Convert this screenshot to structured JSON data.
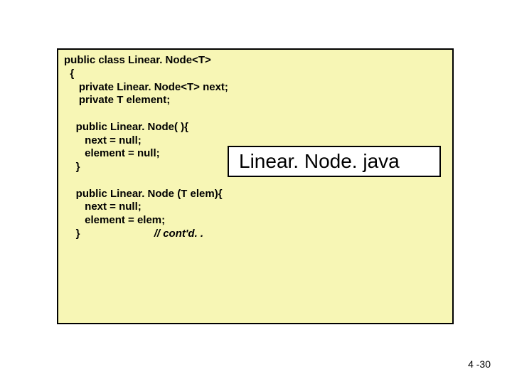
{
  "code": {
    "line1": "public class Linear. Node<T>",
    "line2": "  {",
    "line3": "     private Linear. Node<T> next;",
    "line4": "     private T element;",
    "line5": "",
    "line6": "    public Linear. Node( ){",
    "line7": "       next = null;",
    "line8": "       element = null;",
    "line9": "    }",
    "line10": "",
    "line11": "    public Linear. Node (T elem){",
    "line12": "       next = null;",
    "line13": "       element = elem;",
    "line14_a": "    }                         ",
    "line14_b": "// cont'd. ."
  },
  "label": "Linear. Node. java",
  "footer": "4 -30"
}
